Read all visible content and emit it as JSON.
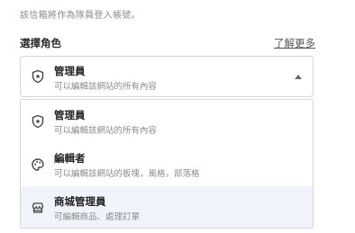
{
  "helper_text": "該信箱將作為隊員登入帳號。",
  "role_field": {
    "label": "選擇角色",
    "learn_more": "了解更多"
  },
  "selected": {
    "title": "管理員",
    "description": "可以編輯該網站的所有內容",
    "icon": "shield-star-icon"
  },
  "options": [
    {
      "title": "管理員",
      "description": "可以編輯該網站的所有內容",
      "icon": "shield-star-icon"
    },
    {
      "title": "編輯者",
      "description": "可以編輯該網站的板塊，風格，部落格",
      "icon": "palette-icon"
    },
    {
      "title": "商城管理員",
      "description": "可編輯商品、處理訂單",
      "icon": "store-icon"
    }
  ],
  "colors": {
    "highlight": "#f0f4fa",
    "border": "#d6d6d6",
    "text_primary": "#222222",
    "text_secondary": "#8c8c8c"
  }
}
